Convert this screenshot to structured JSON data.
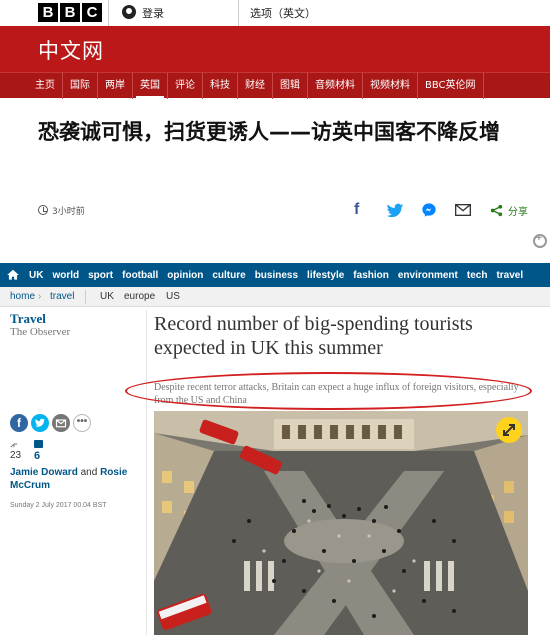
{
  "bbc": {
    "logo_letters": [
      "B",
      "B",
      "C"
    ],
    "signin_label": "登录",
    "options_label": "选项（英文）",
    "section_title": "中文网",
    "nav_items": [
      {
        "label": "主页"
      },
      {
        "label": "国际"
      },
      {
        "label": "两岸"
      },
      {
        "label": "英国"
      },
      {
        "label": "评论"
      },
      {
        "label": "科技"
      },
      {
        "label": "财经"
      },
      {
        "label": "图辑"
      },
      {
        "label": "音频材料"
      },
      {
        "label": "视频材料"
      },
      {
        "label": "BBC英伦网"
      }
    ],
    "active_nav": "英国",
    "headline": "恐袭诚可惧，扫货更诱人——访英中国客不降反增",
    "timestamp": "3小时前",
    "share_label": "分享",
    "colors": {
      "red": "#bb1919",
      "nav_red": "#a91717"
    }
  },
  "guardian": {
    "nav_items": [
      {
        "label": "UK"
      },
      {
        "label": "world"
      },
      {
        "label": "sport"
      },
      {
        "label": "football"
      },
      {
        "label": "opinion"
      },
      {
        "label": "culture"
      },
      {
        "label": "business"
      },
      {
        "label": "lifestyle"
      },
      {
        "label": "fashion"
      },
      {
        "label": "environment"
      },
      {
        "label": "tech"
      },
      {
        "label": "travel"
      }
    ],
    "breadcrumb": {
      "home": "home",
      "separator": "›",
      "section": "travel"
    },
    "subnav": [
      "UK",
      "europe",
      "US"
    ],
    "section": "Travel",
    "publication": "The Observer",
    "headline": "Record number of big-spending tourists expected in UK this summer",
    "standfirst": "Despite recent terror attacks, Britain can expect a huge influx of foreign visitors, especially from the US and China",
    "share_count": "23",
    "comment_count": "6",
    "byline": {
      "author1": "Jamie Doward",
      "joiner": " and ",
      "author2": "Rosie McCrum"
    },
    "date": "Sunday 2 July 2017 00.04 BST",
    "more_label": "•••",
    "fb_letter": "f",
    "colors": {
      "blue": "#005689",
      "highlight_ellipse": "#d21f1f"
    }
  }
}
